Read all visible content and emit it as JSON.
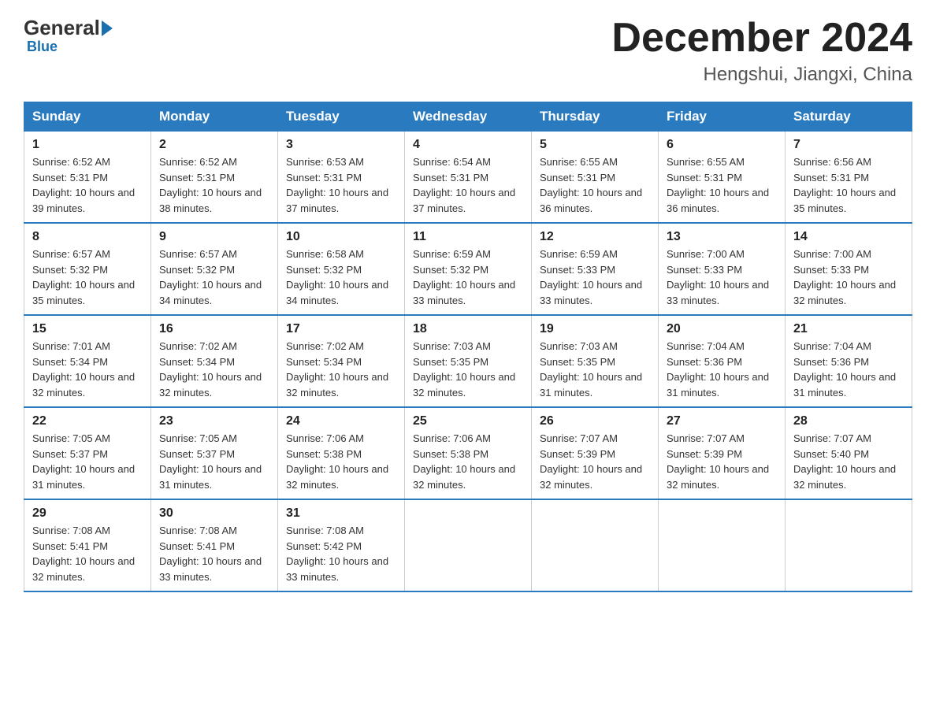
{
  "logo": {
    "general": "General",
    "triangle": "▶",
    "blue": "Blue"
  },
  "header": {
    "title": "December 2024",
    "subtitle": "Hengshui, Jiangxi, China"
  },
  "days_of_week": [
    "Sunday",
    "Monday",
    "Tuesday",
    "Wednesday",
    "Thursday",
    "Friday",
    "Saturday"
  ],
  "weeks": [
    [
      {
        "day": "1",
        "sunrise": "6:52 AM",
        "sunset": "5:31 PM",
        "daylight": "10 hours and 39 minutes."
      },
      {
        "day": "2",
        "sunrise": "6:52 AM",
        "sunset": "5:31 PM",
        "daylight": "10 hours and 38 minutes."
      },
      {
        "day": "3",
        "sunrise": "6:53 AM",
        "sunset": "5:31 PM",
        "daylight": "10 hours and 37 minutes."
      },
      {
        "day": "4",
        "sunrise": "6:54 AM",
        "sunset": "5:31 PM",
        "daylight": "10 hours and 37 minutes."
      },
      {
        "day": "5",
        "sunrise": "6:55 AM",
        "sunset": "5:31 PM",
        "daylight": "10 hours and 36 minutes."
      },
      {
        "day": "6",
        "sunrise": "6:55 AM",
        "sunset": "5:31 PM",
        "daylight": "10 hours and 36 minutes."
      },
      {
        "day": "7",
        "sunrise": "6:56 AM",
        "sunset": "5:31 PM",
        "daylight": "10 hours and 35 minutes."
      }
    ],
    [
      {
        "day": "8",
        "sunrise": "6:57 AM",
        "sunset": "5:32 PM",
        "daylight": "10 hours and 35 minutes."
      },
      {
        "day": "9",
        "sunrise": "6:57 AM",
        "sunset": "5:32 PM",
        "daylight": "10 hours and 34 minutes."
      },
      {
        "day": "10",
        "sunrise": "6:58 AM",
        "sunset": "5:32 PM",
        "daylight": "10 hours and 34 minutes."
      },
      {
        "day": "11",
        "sunrise": "6:59 AM",
        "sunset": "5:32 PM",
        "daylight": "10 hours and 33 minutes."
      },
      {
        "day": "12",
        "sunrise": "6:59 AM",
        "sunset": "5:33 PM",
        "daylight": "10 hours and 33 minutes."
      },
      {
        "day": "13",
        "sunrise": "7:00 AM",
        "sunset": "5:33 PM",
        "daylight": "10 hours and 33 minutes."
      },
      {
        "day": "14",
        "sunrise": "7:00 AM",
        "sunset": "5:33 PM",
        "daylight": "10 hours and 32 minutes."
      }
    ],
    [
      {
        "day": "15",
        "sunrise": "7:01 AM",
        "sunset": "5:34 PM",
        "daylight": "10 hours and 32 minutes."
      },
      {
        "day": "16",
        "sunrise": "7:02 AM",
        "sunset": "5:34 PM",
        "daylight": "10 hours and 32 minutes."
      },
      {
        "day": "17",
        "sunrise": "7:02 AM",
        "sunset": "5:34 PM",
        "daylight": "10 hours and 32 minutes."
      },
      {
        "day": "18",
        "sunrise": "7:03 AM",
        "sunset": "5:35 PM",
        "daylight": "10 hours and 32 minutes."
      },
      {
        "day": "19",
        "sunrise": "7:03 AM",
        "sunset": "5:35 PM",
        "daylight": "10 hours and 31 minutes."
      },
      {
        "day": "20",
        "sunrise": "7:04 AM",
        "sunset": "5:36 PM",
        "daylight": "10 hours and 31 minutes."
      },
      {
        "day": "21",
        "sunrise": "7:04 AM",
        "sunset": "5:36 PM",
        "daylight": "10 hours and 31 minutes."
      }
    ],
    [
      {
        "day": "22",
        "sunrise": "7:05 AM",
        "sunset": "5:37 PM",
        "daylight": "10 hours and 31 minutes."
      },
      {
        "day": "23",
        "sunrise": "7:05 AM",
        "sunset": "5:37 PM",
        "daylight": "10 hours and 31 minutes."
      },
      {
        "day": "24",
        "sunrise": "7:06 AM",
        "sunset": "5:38 PM",
        "daylight": "10 hours and 32 minutes."
      },
      {
        "day": "25",
        "sunrise": "7:06 AM",
        "sunset": "5:38 PM",
        "daylight": "10 hours and 32 minutes."
      },
      {
        "day": "26",
        "sunrise": "7:07 AM",
        "sunset": "5:39 PM",
        "daylight": "10 hours and 32 minutes."
      },
      {
        "day": "27",
        "sunrise": "7:07 AM",
        "sunset": "5:39 PM",
        "daylight": "10 hours and 32 minutes."
      },
      {
        "day": "28",
        "sunrise": "7:07 AM",
        "sunset": "5:40 PM",
        "daylight": "10 hours and 32 minutes."
      }
    ],
    [
      {
        "day": "29",
        "sunrise": "7:08 AM",
        "sunset": "5:41 PM",
        "daylight": "10 hours and 32 minutes."
      },
      {
        "day": "30",
        "sunrise": "7:08 AM",
        "sunset": "5:41 PM",
        "daylight": "10 hours and 33 minutes."
      },
      {
        "day": "31",
        "sunrise": "7:08 AM",
        "sunset": "5:42 PM",
        "daylight": "10 hours and 33 minutes."
      },
      null,
      null,
      null,
      null
    ]
  ]
}
